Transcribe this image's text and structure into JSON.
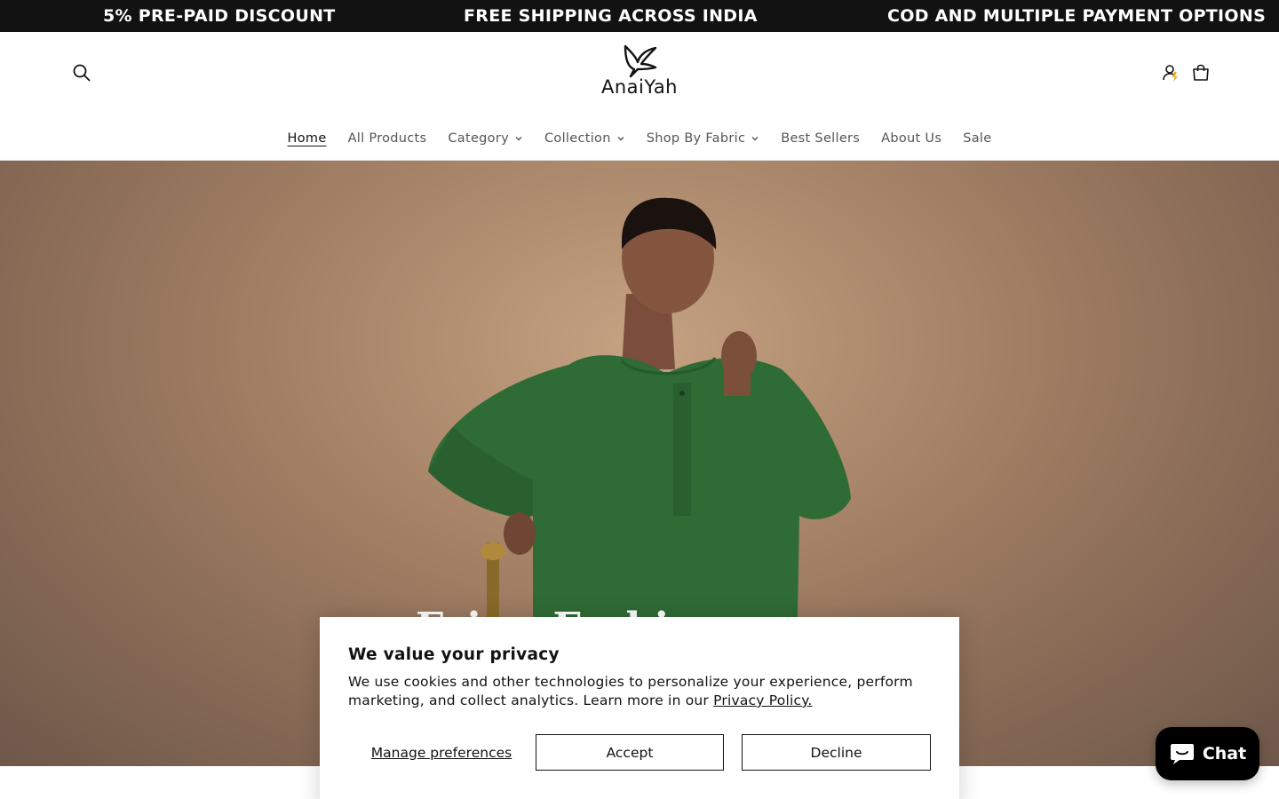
{
  "announcement": {
    "items": [
      "5% PRE-PAID DISCOUNT",
      "FREE SHIPPING ACROSS INDIA",
      "COD AND MULTIPLE PAYMENT OPTIONS"
    ]
  },
  "header": {
    "logo_text": "AnaiYah",
    "search_icon": "search-icon",
    "account_icon": "account-icon",
    "cart_icon": "cart-icon"
  },
  "nav": {
    "items": [
      {
        "label": "Home",
        "active": true,
        "dropdown": false
      },
      {
        "label": "All Products",
        "active": false,
        "dropdown": false
      },
      {
        "label": "Category",
        "active": false,
        "dropdown": true
      },
      {
        "label": "Collection",
        "active": false,
        "dropdown": true
      },
      {
        "label": "Shop By Fabric",
        "active": false,
        "dropdown": true
      },
      {
        "label": "Best Sellers",
        "active": false,
        "dropdown": false
      },
      {
        "label": "About Us",
        "active": false,
        "dropdown": false
      },
      {
        "label": "Sale",
        "active": false,
        "dropdown": false
      }
    ]
  },
  "hero": {
    "heading": "Fair...  Fashi..."
  },
  "cookie": {
    "title": "We value your privacy",
    "text": "We use cookies and other technologies to personalize your experience, perform marketing, and collect analytics. Learn more in our",
    "link": "Privacy Policy.",
    "manage_label": "Manage preferences",
    "accept_label": "Accept",
    "decline_label": "Decline"
  },
  "chat": {
    "label": "Chat"
  },
  "colors": {
    "announcement_bg": "#121212",
    "chat_bg": "#000000",
    "hero_garment": "#2f6b35"
  }
}
